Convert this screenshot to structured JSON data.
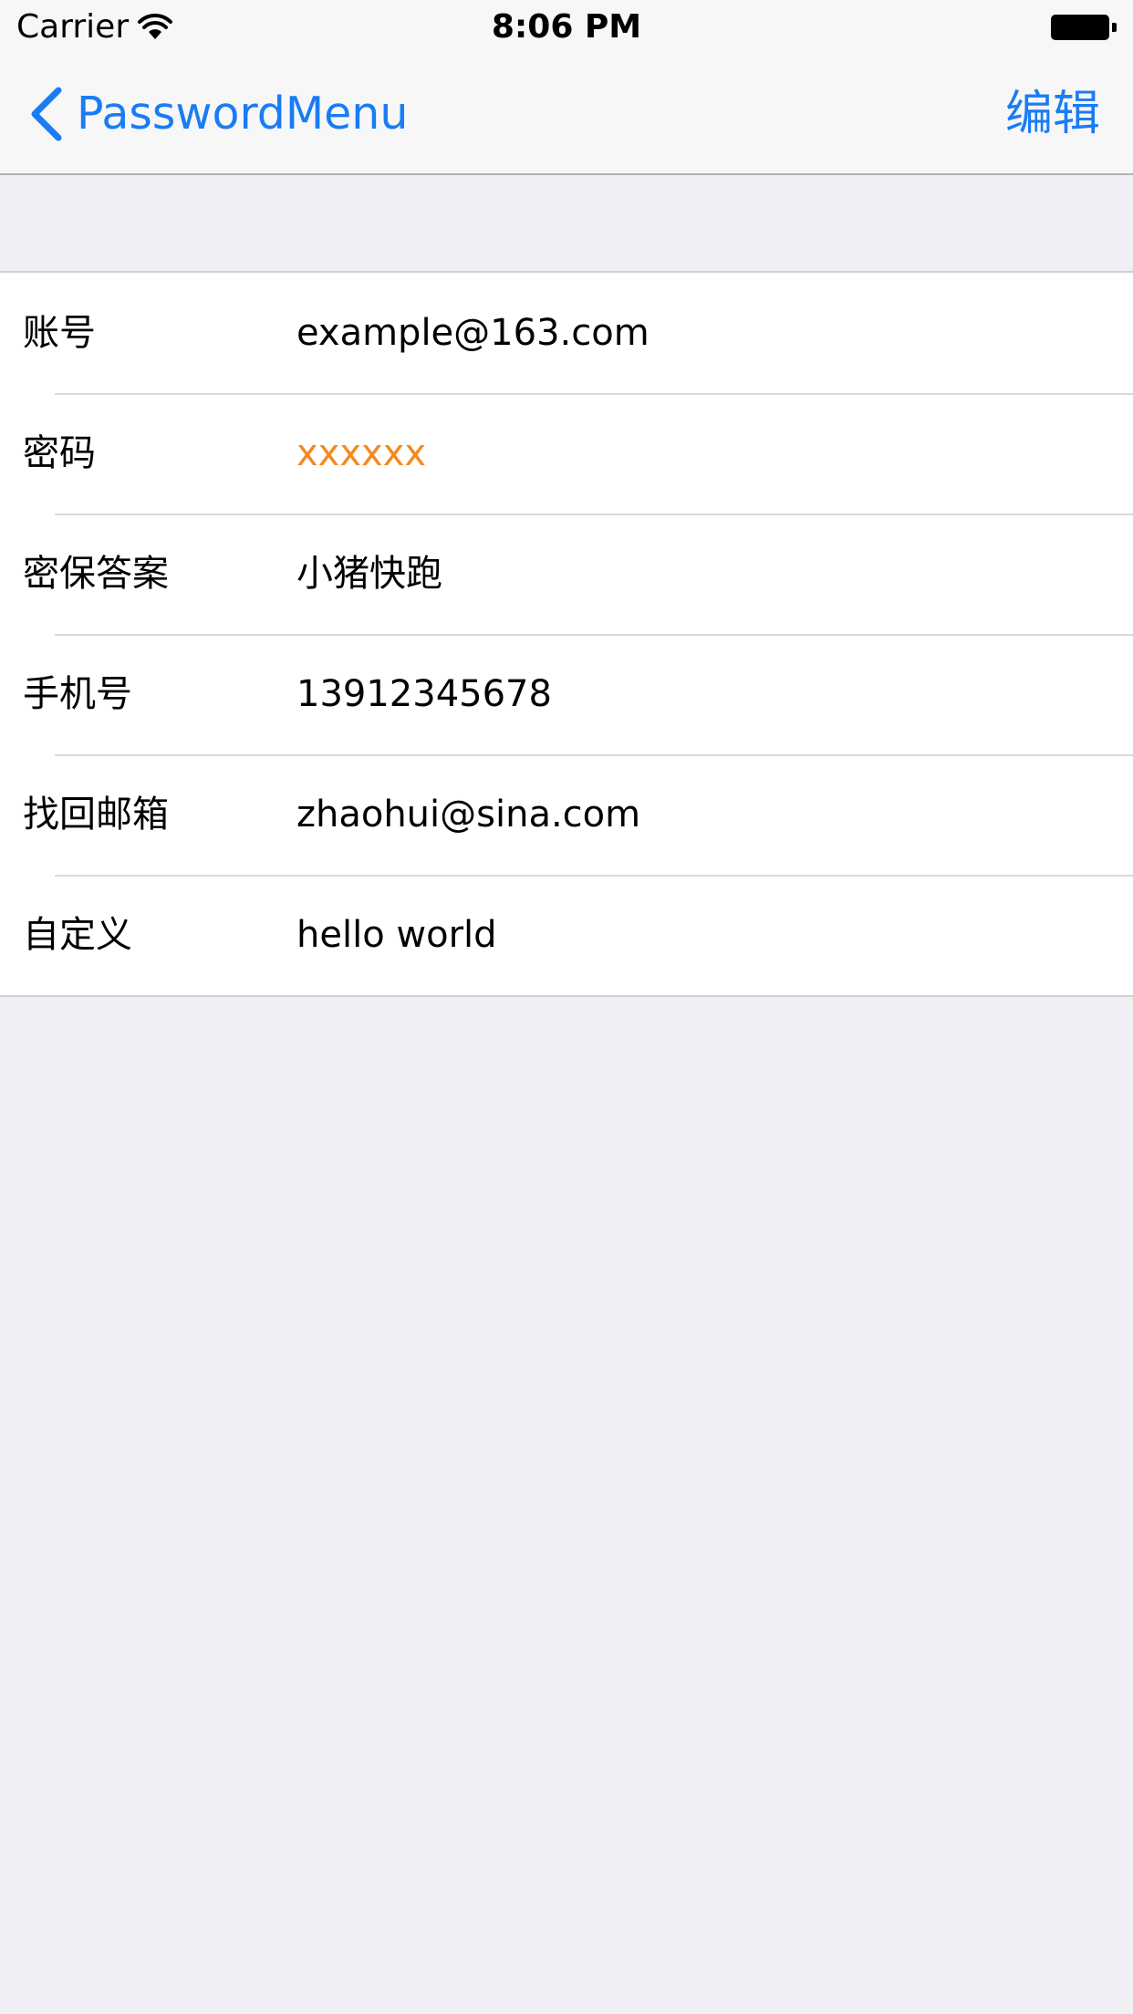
{
  "status_bar": {
    "carrier": "Carrier",
    "time": "8:06 PM"
  },
  "nav": {
    "back_label": "PasswordMenu",
    "edit_label": "编辑"
  },
  "fields": [
    {
      "label": "账号",
      "value": "example@163.com"
    },
    {
      "label": "密码",
      "value": "xxxxxx"
    },
    {
      "label": "密保答案",
      "value": "小猪快跑"
    },
    {
      "label": "手机号",
      "value": "13912345678"
    },
    {
      "label": "找回邮箱",
      "value": "zhaohui@sina.com"
    },
    {
      "label": "自定义",
      "value": "hello world"
    }
  ],
  "colors": {
    "accent": "#1a7cf5",
    "password_value": "#f5891c",
    "background": "#efeff4"
  },
  "icons": {
    "back": "chevron-left-icon",
    "wifi": "wifi-icon",
    "battery": "battery-icon"
  }
}
